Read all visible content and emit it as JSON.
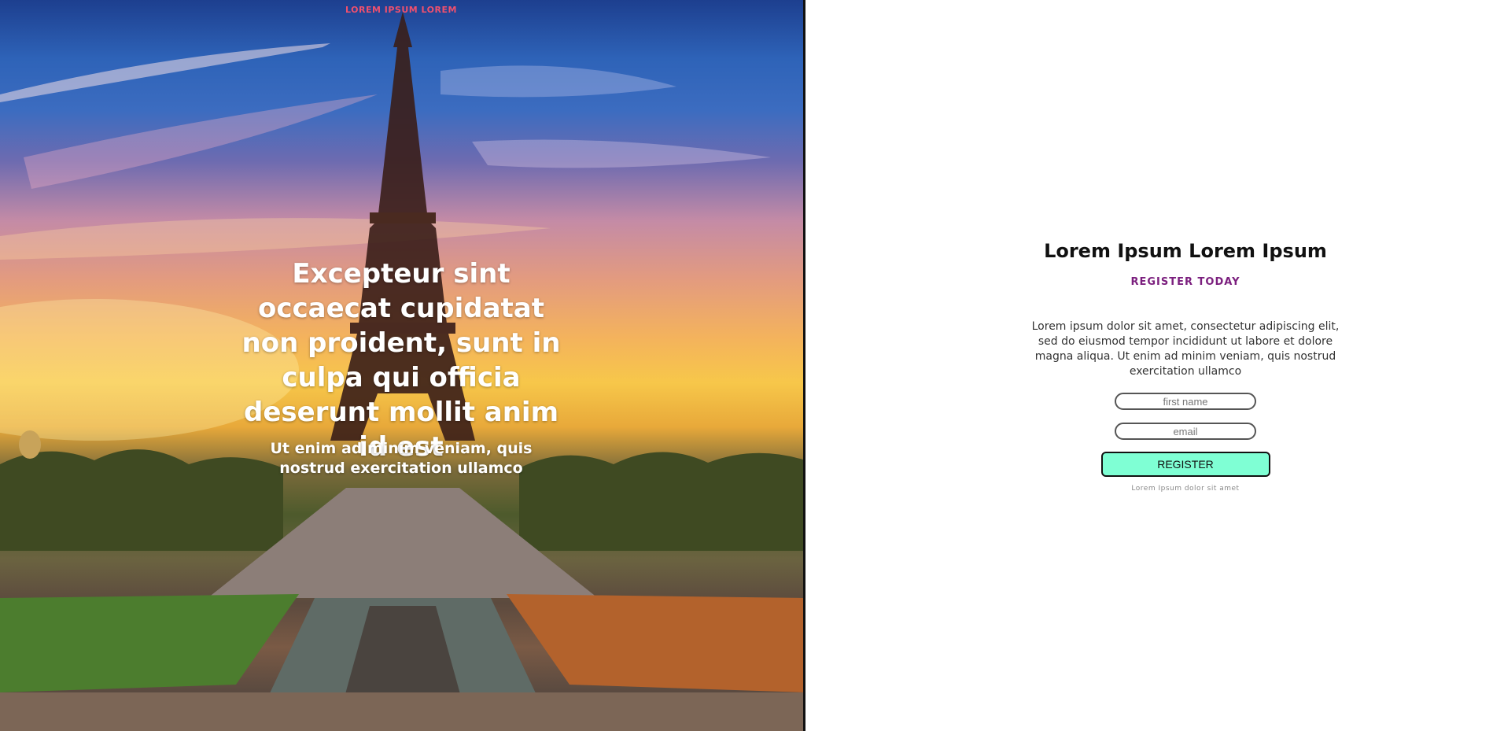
{
  "hero": {
    "kicker": "LOREM IPSUM LOREM",
    "title": "Excepteur sint occaecat cupidatat non proident, sunt in culpa qui officia deserunt mollit anim id est",
    "subtitle": "Ut enim ad minim veniam, quis nostrud exercitation ullamco",
    "image": "eiffel-tower-sunset-photo"
  },
  "form": {
    "title": "Lorem Ipsum Lorem Ipsum",
    "kicker": "REGISTER TODAY",
    "description": "Lorem ipsum dolor sit amet, consectetur adipiscing elit, sed do eiusmod tempor incididunt ut labore et dolore magna aliqua. Ut enim ad minim veniam, quis nostrud exercitation ullamco",
    "first_name_placeholder": "first name",
    "email_placeholder": "email",
    "register_label": "REGISTER",
    "fine_print": "Lorem Ipsum dolor sit amet"
  },
  "colors": {
    "kicker_hero": "#f0506e",
    "kicker_form": "#7b1f7e",
    "button": "#7fffd4"
  }
}
